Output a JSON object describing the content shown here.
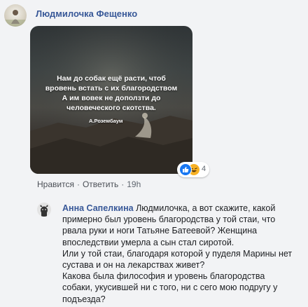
{
  "post": {
    "author": "Людмилочка Фещенко",
    "image_quote_lines": [
      "Нам до собак ещё расти, чтоб",
      "вровень встать с их благородством",
      "А им вовек не доползти до",
      "человеческого скотства."
    ],
    "image_quote_author": "А.Розембаум",
    "reaction_count": "4",
    "actions": {
      "like": "Нравится",
      "reply": "Ответить",
      "time": "19h",
      "separator": "·"
    }
  },
  "reply": {
    "author": "Анна Сапелкина",
    "text_lines": [
      "Людмилочка, а вот скажите, какой",
      "примерно был уровень благородства у той стаи, что",
      "рвала руки и ноги Татьяне Батеевой? Женщина",
      "впоследствии умерла а сын стал сиротой.",
      "Или у той стаи, благодаря которой у пуделя Марины нет",
      "сустава и он на лекарствах живет?",
      "Какова была философия и уровень благородства",
      "собаки, укусившей ни с того, ни с сего мою подругу у",
      "подъезда?"
    ]
  },
  "colors": {
    "link": "#385898",
    "meta": "#606770",
    "background": "#f2f3f5",
    "like_blue": "#1877f2",
    "haha_yellow": "#f7b125"
  },
  "icons": [
    "avatar",
    "like-reaction-icon",
    "haha-reaction-icon",
    "dog-avatar"
  ]
}
